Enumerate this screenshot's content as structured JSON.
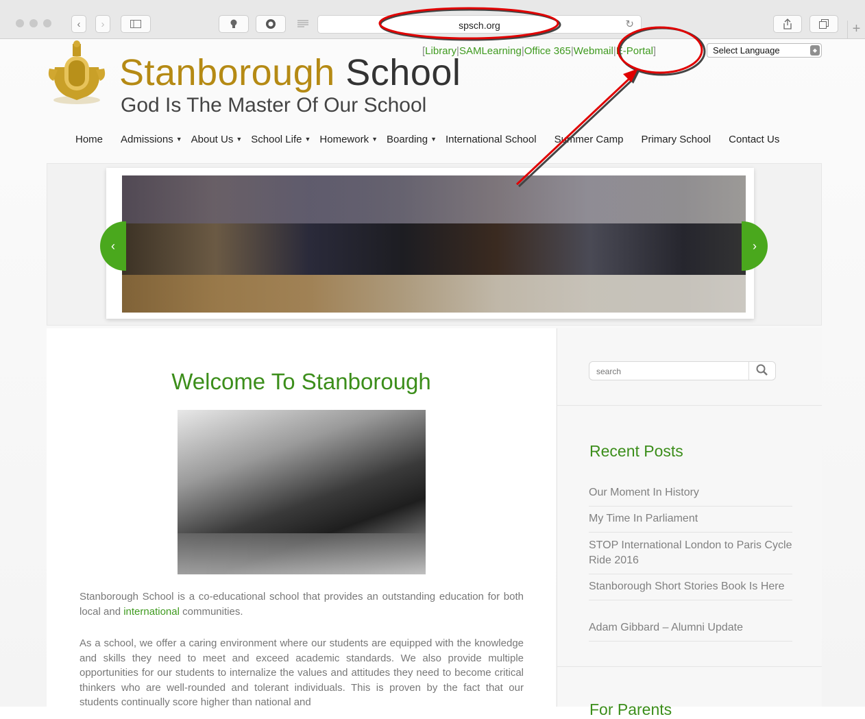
{
  "browser": {
    "url": "spsch.org",
    "new_tab": "+"
  },
  "header": {
    "title_gold": "Stanborough",
    "title_dark": "School",
    "tagline": "God Is The Master Of Our School",
    "toplinks": [
      "Library",
      "SAMLearning",
      "Office 365",
      "Webmail",
      "E-Portal"
    ],
    "language_select": "Select Language"
  },
  "nav": {
    "items": [
      {
        "label": "Home",
        "dropdown": false
      },
      {
        "label": "Admissions",
        "dropdown": true
      },
      {
        "label": "About Us",
        "dropdown": true
      },
      {
        "label": "School Life",
        "dropdown": true
      },
      {
        "label": "Homework",
        "dropdown": true
      },
      {
        "label": "Boarding",
        "dropdown": true
      },
      {
        "label": "International School",
        "dropdown": false
      },
      {
        "label": "Summer Camp",
        "dropdown": false
      },
      {
        "label": "Primary School",
        "dropdown": false
      },
      {
        "label": "Contact Us",
        "dropdown": false
      }
    ]
  },
  "slider": {
    "prev": "‹",
    "next": "›"
  },
  "main": {
    "welcome": "Welcome To Stanborough",
    "p1_a": "Stanborough School is a co-educational school that provides an outstanding education for both local and ",
    "p1_link": "international",
    "p1_b": " communities.",
    "p2": "As a school, we offer a caring environment where our students are equipped with the knowledge and skills they need to meet and exceed academic standards. We also provide multiple opportunities for our students to internalize the values and attitudes they need to become critical thinkers who are well-rounded and tolerant individuals. This is proven by the fact that our students continually score higher than national and"
  },
  "sidebar": {
    "search_placeholder": "search",
    "recent_posts_title": "Recent Posts",
    "posts": [
      "Our Moment In History",
      "My Time In Parliament",
      "STOP International London to Paris Cycle Ride 2016",
      "Stanborough Short Stories Book Is Here",
      "Adam Gibbard – Alumni Update"
    ],
    "for_parents_title": "For Parents"
  },
  "colors": {
    "accent_green": "#3c8e1b",
    "gold": "#b58a14",
    "annotation_red": "#e00000"
  }
}
